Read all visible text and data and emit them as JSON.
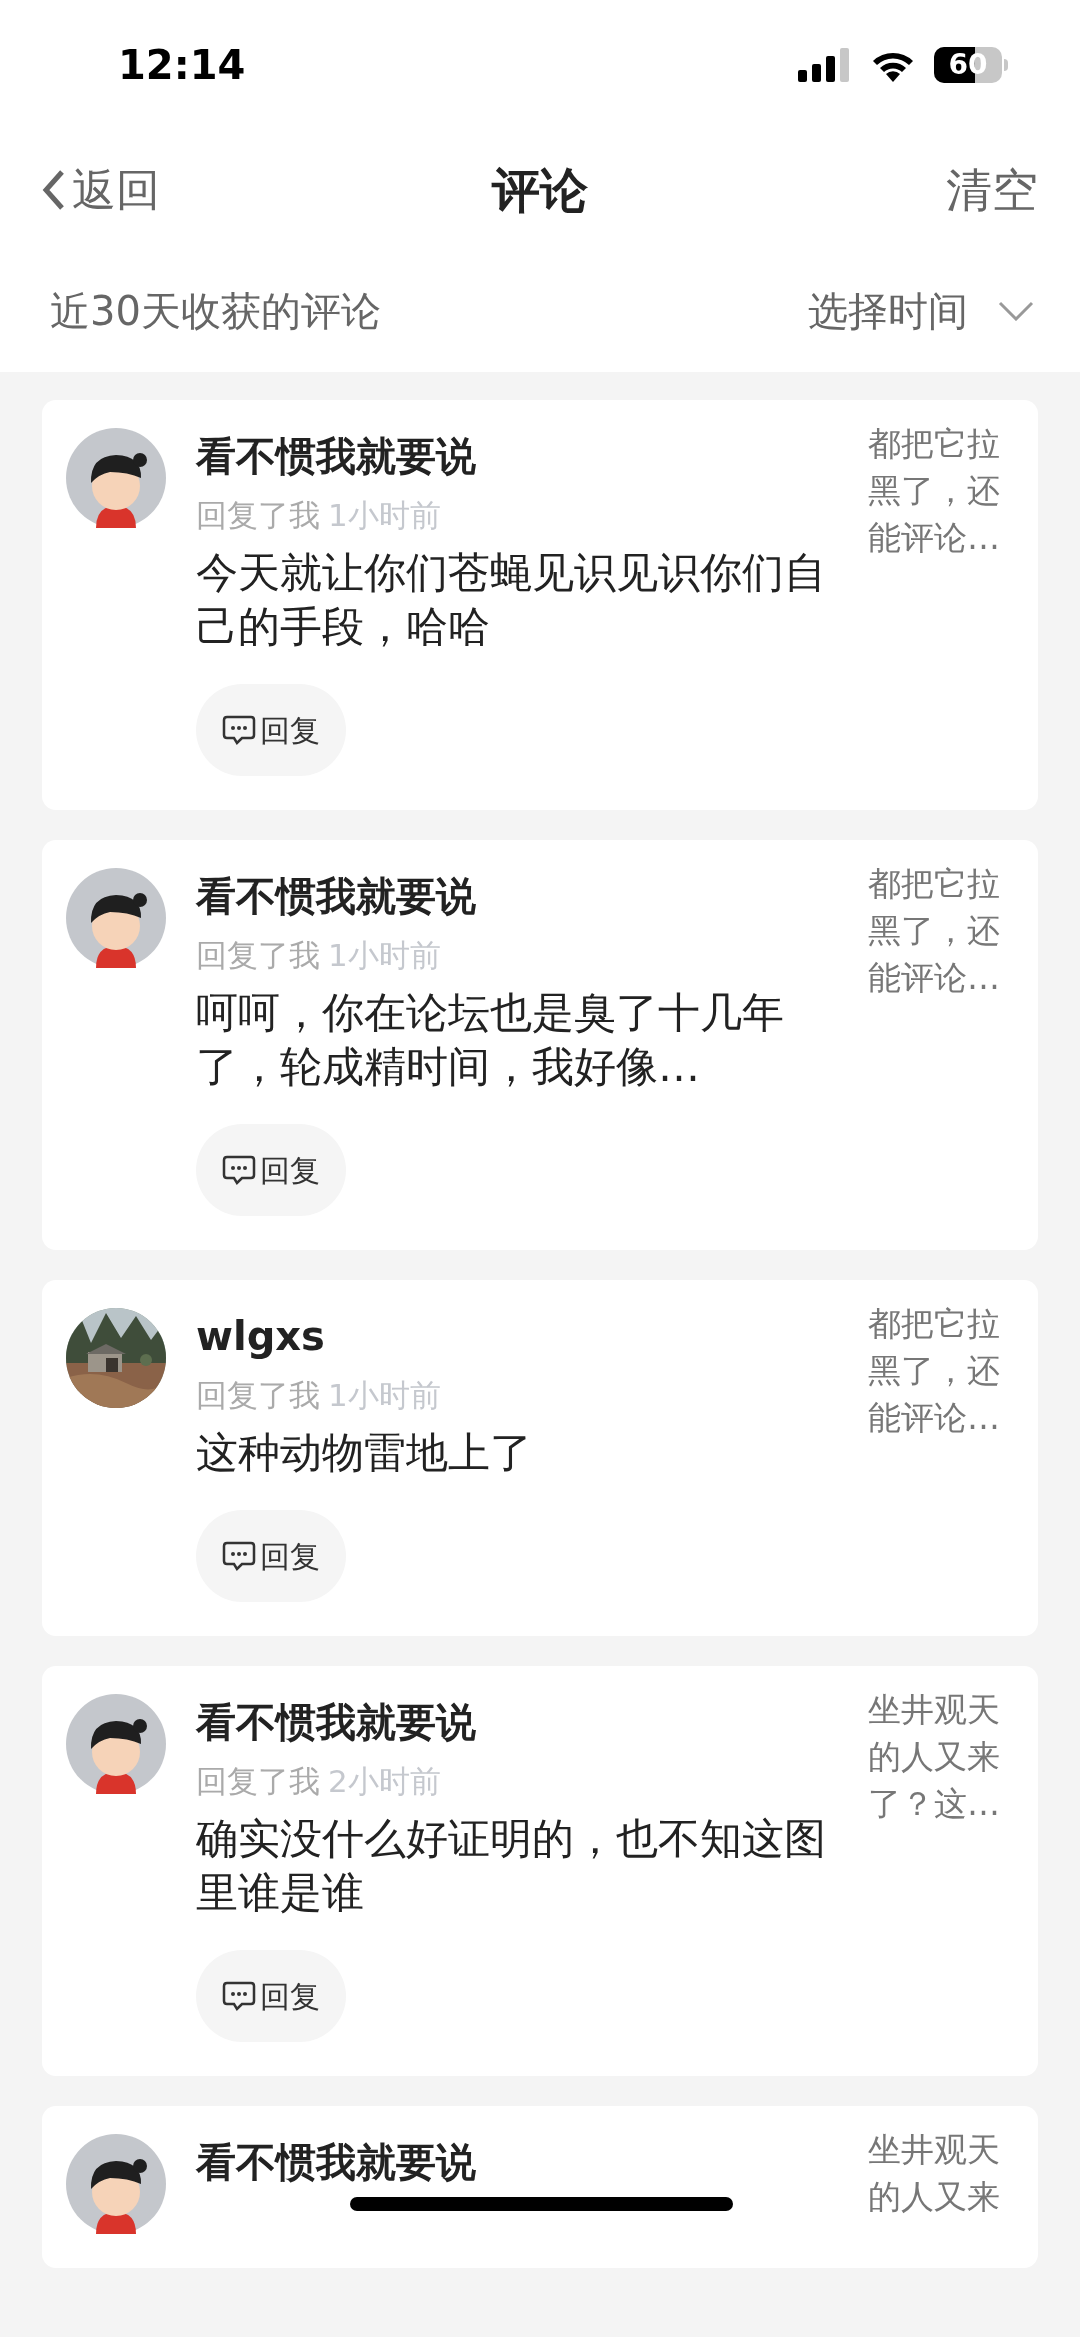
{
  "status_bar": {
    "time": "12:14",
    "battery": "60"
  },
  "nav": {
    "back": "返回",
    "title": "评论",
    "action": "清空"
  },
  "filter": {
    "label": "近30天收获的评论",
    "picker": "选择时间"
  },
  "comments": [
    {
      "avatar": {
        "kind": "cartoon"
      },
      "name": "看不惯我就要说",
      "action": "回复了我",
      "time": "1小时前",
      "text": "今天就让你们苍蝇见识见识你们自己的手段，哈哈",
      "reply": "回复",
      "snippet": "都把它拉黑了，还能评论…"
    },
    {
      "avatar": {
        "kind": "cartoon"
      },
      "name": "看不惯我就要说",
      "action": "回复了我",
      "time": "1小时前",
      "text": "呵呵，你在论坛也是臭了十几年了，轮成精时间，我好像…",
      "reply": "回复",
      "snippet": "都把它拉黑了，还能评论…"
    },
    {
      "name": "wlgxs",
      "action": "回复了我",
      "time": "1小时前",
      "text": "这种动物雷地上了",
      "reply": "回复",
      "snippet": "都把它拉黑了，还能评论…"
    },
    {
      "avatar": {
        "kind": "cartoon"
      },
      "name": "看不惯我就要说",
      "action": "回复了我",
      "time": "2小时前",
      "text": "确实没什么好证明的，也不知这图里谁是谁",
      "reply": "回复",
      "snippet": "坐井观天的人又来了？这…"
    },
    {
      "avatar": {
        "kind": "cartoon"
      },
      "name": "看不惯我就要说",
      "snippet": "坐井观天的人又来"
    }
  ]
}
